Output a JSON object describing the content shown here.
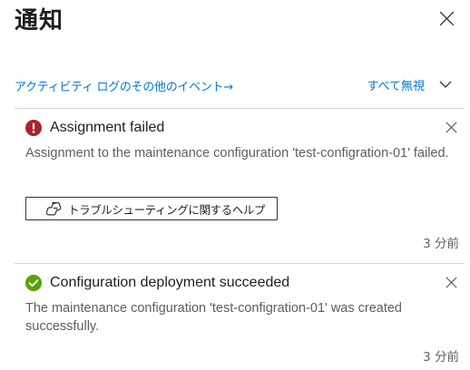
{
  "panel": {
    "title": "通知",
    "close_icon": "close-icon"
  },
  "actions": {
    "activity_log_link": "アクティビティ ログのその他のイベント→",
    "dismiss_all": "すべて無視",
    "expand_icon": "chevron-down-icon"
  },
  "notifications": [
    {
      "status": "error",
      "status_icon": "error-circle-icon",
      "status_color": "#a4262c",
      "title": "Assignment failed",
      "message": "Assignment to the maintenance configuration 'test-configration-01' failed.",
      "help_button": {
        "label": "トラブルシューティングに関するヘルプ",
        "icon": "copilot-icon"
      },
      "time": "3 分前"
    },
    {
      "status": "success",
      "status_icon": "success-check-icon",
      "status_color": "#57a300",
      "title": "Configuration deployment succeeded",
      "message": "The maintenance configuration 'test-configration-01' was created successfully.",
      "time": "3 分前"
    }
  ]
}
